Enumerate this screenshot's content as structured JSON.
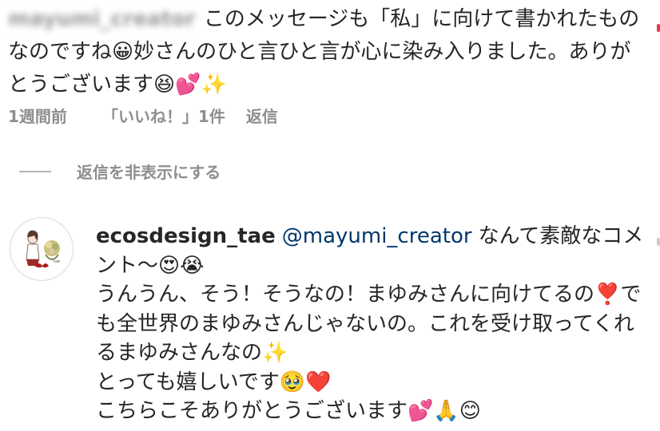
{
  "parent_comment": {
    "username": "mayumi_creator",
    "text": "このメッセージも「私」に向けて書かれたものなのですね😀妙さんのひと言ひと言が心に染み入りました。ありがとうございます😆💕✨",
    "time": "1週間前",
    "likes": "「いいね！」1件",
    "reply_label": "返信"
  },
  "hide_replies": {
    "label": "返信を非表示にする"
  },
  "reply_comment": {
    "username": "ecosdesign_tae",
    "mention": "@mayumi_creator",
    "lines": [
      "なんて素敵なコメント〜😍😭",
      "うんうん、そう！そうなの！まゆみさんに向けてるの❣️でも全世界のまゆみさんじゃないの。これを受け取ってくれるまゆみさんなの✨",
      "とっても嬉しいです🥹❤️",
      "こちらこそありがとうございます💕🙏😊"
    ]
  },
  "colors": {
    "text": "#262626",
    "secondary": "#8e8e8e",
    "mention": "#00376b"
  }
}
